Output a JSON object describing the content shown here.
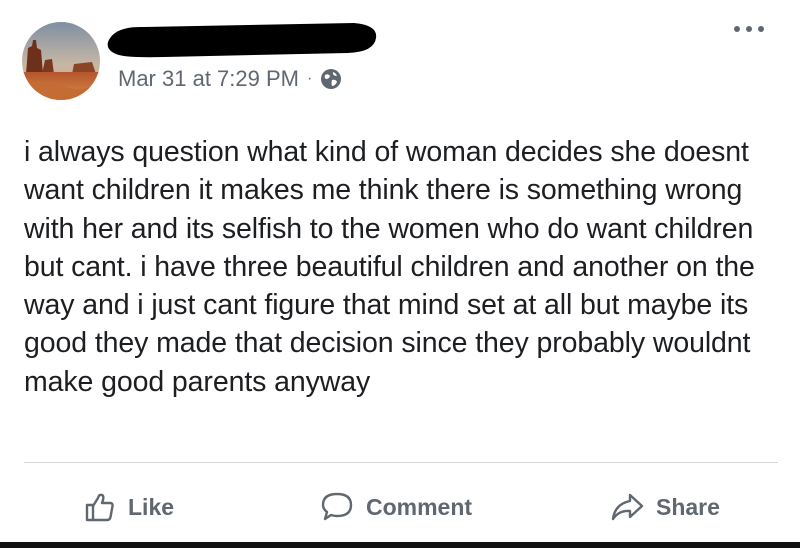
{
  "post": {
    "author_redacted": true,
    "timestamp": "Mar 31 at 7:29 PM",
    "separator": "·",
    "privacy_icon": "globe-icon",
    "more_icon": "more-options-icon",
    "text": "i always question what kind of woman decides she doesnt want children it makes me think there is something wrong with her and its selfish to the women who do want children but cant. i have three beautiful children and another on the way and i just cant figure that mind set at all but maybe its good they made that decision since they probably wouldnt make good parents anyway"
  },
  "actions": {
    "like": "Like",
    "comment": "Comment",
    "share": "Share"
  },
  "colors": {
    "text": "#1c1e21",
    "secondary": "#606770",
    "divider": "#d5d7da"
  }
}
